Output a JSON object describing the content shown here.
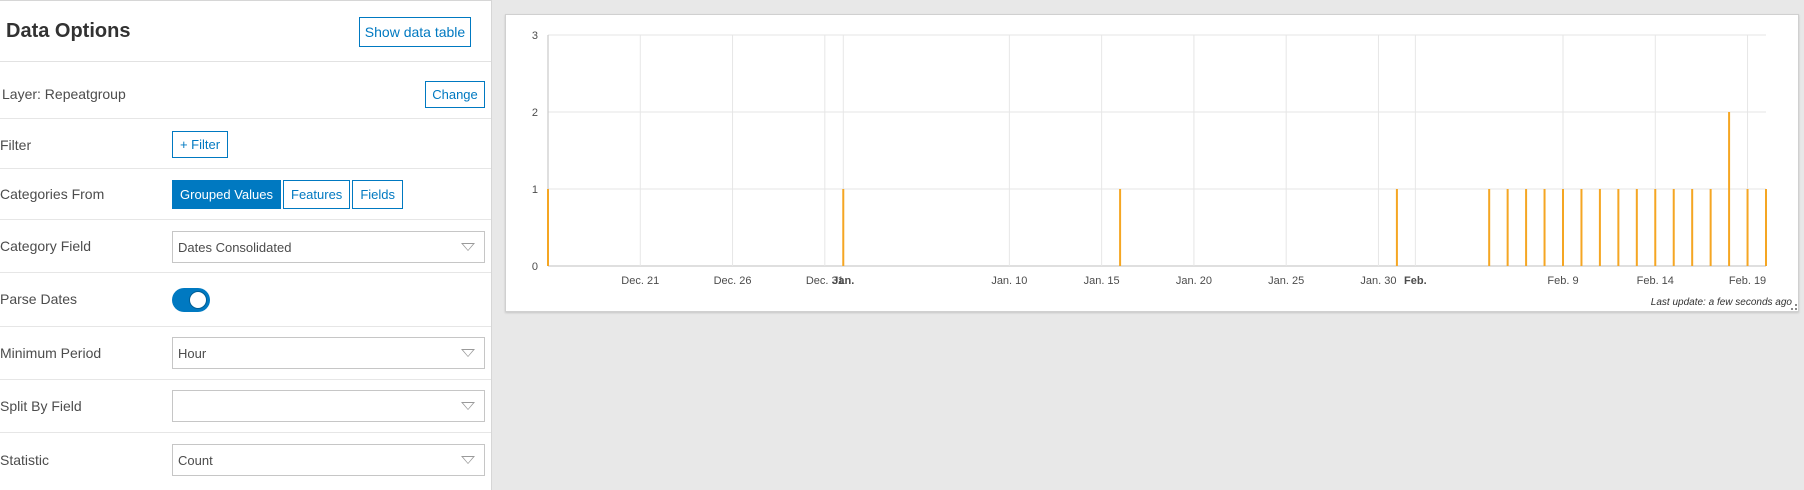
{
  "panel": {
    "title": "Data Options",
    "show_table_label": "Show data table",
    "layer": {
      "label": "Layer: Repeatgroup",
      "change_label": "Change"
    },
    "filter": {
      "label": "Filter",
      "button_label": "+ Filter"
    },
    "categories": {
      "label": "Categories From",
      "options": [
        "Grouped Values",
        "Features",
        "Fields"
      ],
      "selected": "Grouped Values"
    },
    "category_field": {
      "label": "Category Field",
      "value": "Dates Consolidated"
    },
    "parse_dates": {
      "label": "Parse Dates",
      "enabled": true
    },
    "minimum_period": {
      "label": "Minimum Period",
      "value": "Hour"
    },
    "split_by": {
      "label": "Split By Field",
      "value": ""
    },
    "statistic": {
      "label": "Statistic",
      "value": "Count"
    }
  },
  "chart": {
    "last_update": "Last update: a few seconds ago"
  },
  "colors": {
    "accent": "#0079c1",
    "bar": "#f5a623",
    "grid": "#e6e6e6"
  },
  "chart_data": {
    "type": "bar",
    "title": "",
    "xlabel": "",
    "ylabel": "",
    "x_type": "date",
    "xlim": [
      "2018-12-16",
      "2019-02-20"
    ],
    "ylim": [
      0,
      3
    ],
    "y_ticks": [
      0,
      1,
      2,
      3
    ],
    "x_ticks": [
      {
        "date": "2018-12-21",
        "label": "Dec. 21",
        "bold": false
      },
      {
        "date": "2018-12-26",
        "label": "Dec. 26",
        "bold": false
      },
      {
        "date": "2018-12-31",
        "label": "Dec. 31",
        "bold": false
      },
      {
        "date": "2019-01-01",
        "label": "Jan.",
        "bold": true
      },
      {
        "date": "2019-01-10",
        "label": "Jan. 10",
        "bold": false
      },
      {
        "date": "2019-01-15",
        "label": "Jan. 15",
        "bold": false
      },
      {
        "date": "2019-01-20",
        "label": "Jan. 20",
        "bold": false
      },
      {
        "date": "2019-01-25",
        "label": "Jan. 25",
        "bold": false
      },
      {
        "date": "2019-01-30",
        "label": "Jan. 30",
        "bold": false
      },
      {
        "date": "2019-02-01",
        "label": "Feb.",
        "bold": true
      },
      {
        "date": "2019-02-09",
        "label": "Feb. 9",
        "bold": false
      },
      {
        "date": "2019-02-14",
        "label": "Feb. 14",
        "bold": false
      },
      {
        "date": "2019-02-19",
        "label": "Feb. 19",
        "bold": false
      }
    ],
    "grid": true,
    "points": [
      {
        "x": "2018-12-16",
        "y": 1
      },
      {
        "x": "2019-01-01",
        "y": 1
      },
      {
        "x": "2019-01-16",
        "y": 1
      },
      {
        "x": "2019-01-31",
        "y": 1
      },
      {
        "x": "2019-02-05",
        "y": 1
      },
      {
        "x": "2019-02-06",
        "y": 1
      },
      {
        "x": "2019-02-07",
        "y": 1
      },
      {
        "x": "2019-02-08",
        "y": 1
      },
      {
        "x": "2019-02-09",
        "y": 1
      },
      {
        "x": "2019-02-10",
        "y": 1
      },
      {
        "x": "2019-02-11",
        "y": 1
      },
      {
        "x": "2019-02-12",
        "y": 1
      },
      {
        "x": "2019-02-13",
        "y": 1
      },
      {
        "x": "2019-02-14",
        "y": 1
      },
      {
        "x": "2019-02-15",
        "y": 1
      },
      {
        "x": "2019-02-16",
        "y": 1
      },
      {
        "x": "2019-02-17",
        "y": 1
      },
      {
        "x": "2019-02-18",
        "y": 2
      },
      {
        "x": "2019-02-19",
        "y": 1
      },
      {
        "x": "2019-02-20",
        "y": 1
      }
    ]
  }
}
